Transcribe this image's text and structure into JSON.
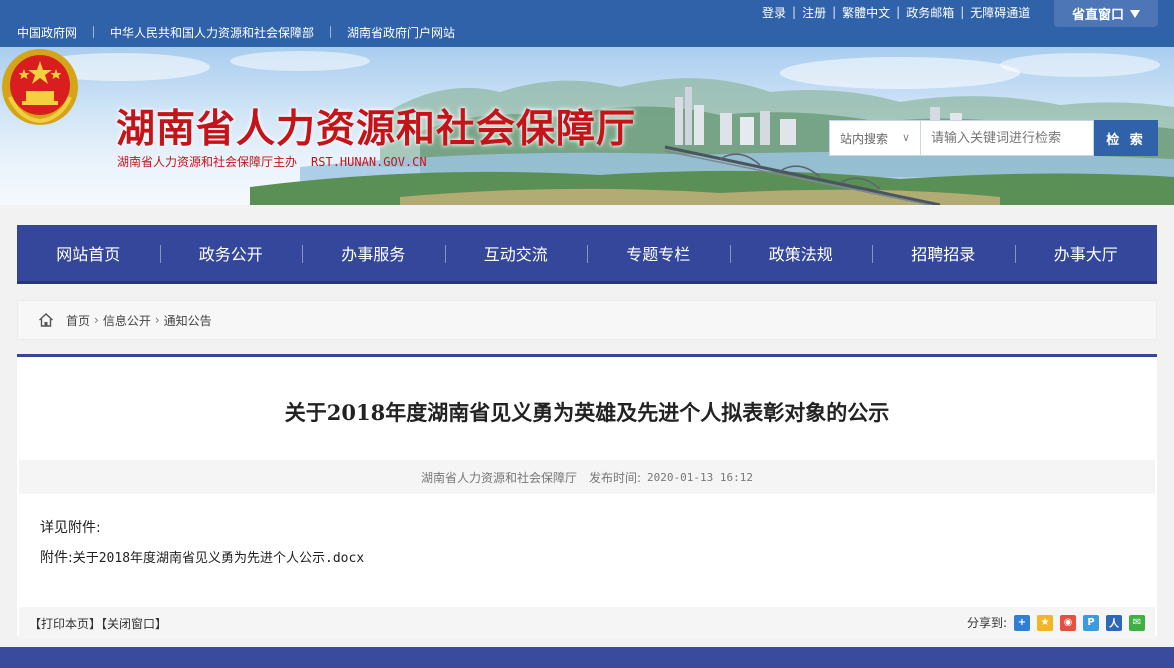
{
  "topbar": {
    "links": [
      "中国政府网",
      "中华人民共和国人力资源和社会保障部",
      "湖南省政府门户网站"
    ],
    "user_links": [
      "登录",
      "注册",
      "繁體中文",
      "政务邮箱",
      "无障碍通道"
    ],
    "province_window": "省直窗口"
  },
  "header": {
    "title": "湖南省人力资源和社会保障厅",
    "subtitle": "湖南省人力资源和社会保障厅主办",
    "domain": "RST.HUNAN.GOV.CN"
  },
  "search": {
    "scope": "站内搜索",
    "placeholder": "请输入关键词进行检索",
    "button": "检 索"
  },
  "nav": [
    "网站首页",
    "政务公开",
    "办事服务",
    "互动交流",
    "专题专栏",
    "政策法规",
    "招聘招录",
    "办事大厅"
  ],
  "breadcrumb": [
    "首页",
    "信息公开",
    "通知公告"
  ],
  "article": {
    "title": "关于2018年度湖南省见义勇为英雄及先进个人拟表彰对象的公示",
    "source": "湖南省人力资源和社会保障厅",
    "time_label": "发布时间:",
    "time": "2020-01-13 16:12",
    "line1": "详见附件:",
    "attach_label": "附件:",
    "attach_name": "关于2018年度湖南省见义勇为先进个人公示.docx"
  },
  "footer_tools": {
    "print": "【打印本页】",
    "close": "【关闭窗口】",
    "share_label": "分享到:"
  },
  "colors": {
    "topbar": "#2f62a8",
    "nav": "#35479b",
    "title_red": "#c4141a"
  }
}
